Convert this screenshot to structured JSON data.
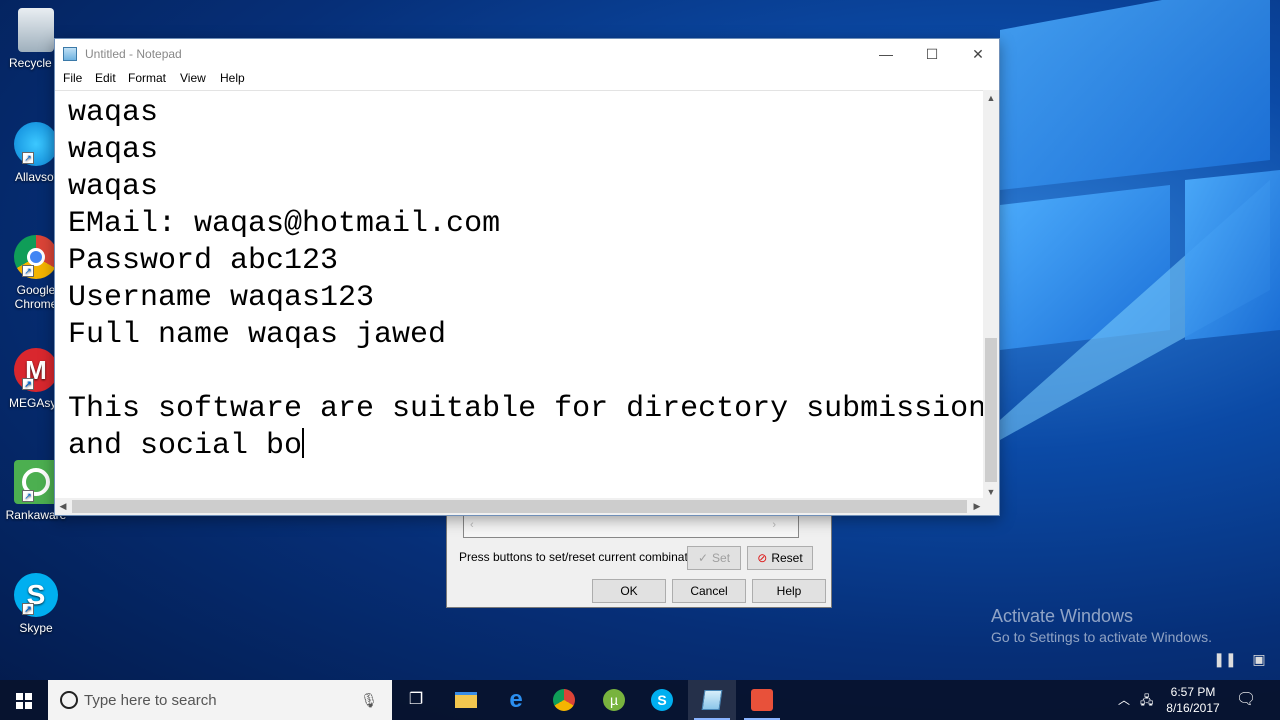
{
  "desktop": {
    "icons": [
      {
        "label": "Recycle B",
        "icon": "recycle-bin-icon"
      },
      {
        "label": "Allavsof",
        "icon": "allavsoft-icon"
      },
      {
        "label": "Google Chrome",
        "icon": "chrome-icon"
      },
      {
        "label": "MEGAsyn",
        "icon": "mega-icon"
      },
      {
        "label": "Rankaware",
        "icon": "rankaware-icon"
      },
      {
        "label": "Skype",
        "icon": "skype-icon"
      }
    ]
  },
  "notepad": {
    "title": "Untitled - Notepad",
    "menu": [
      "File",
      "Edit",
      "Format",
      "View",
      "Help"
    ],
    "lines": [
      "waqas",
      "waqas",
      "waqas",
      "EMail: waqas@hotmail.com",
      "Password abc123",
      "Username waqas123",
      "Full name waqas jawed",
      "",
      "This software are suitable for directory submission",
      "and social bo"
    ]
  },
  "dialog": {
    "hint": "Press buttons to set/reset current combination",
    "set_label": "Set",
    "reset_label": "Reset",
    "ok_label": "OK",
    "cancel_label": "Cancel",
    "help_label": "Help"
  },
  "watermark": {
    "title": "Activate Windows",
    "subtitle": "Go to Settings to activate Windows."
  },
  "taskbar": {
    "search_placeholder": "Type here to search",
    "time": "6:57 PM",
    "date": "8/16/2017",
    "pinned": [
      "task-view-icon",
      "file-explorer-icon",
      "edge-icon",
      "chrome-icon",
      "utorrent-icon",
      "skype-icon",
      "notepad-icon",
      "app-icon"
    ]
  },
  "colors": {
    "desktop_bg": "#0b4aa6",
    "taskbar_bg": "#08122c",
    "notepad_border": "#6f8fb8"
  }
}
